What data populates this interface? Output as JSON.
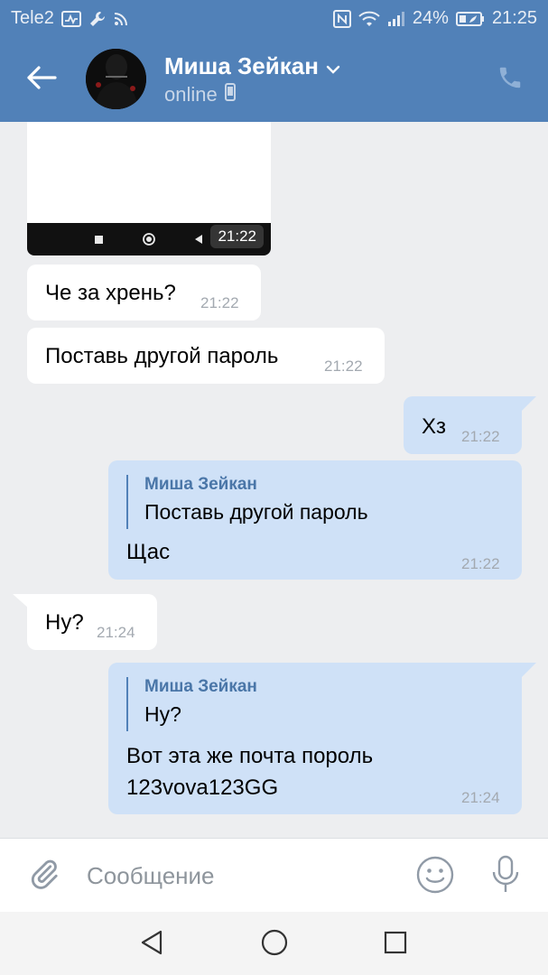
{
  "status_bar": {
    "carrier": "Tele2",
    "battery": "24%",
    "time": "21:25"
  },
  "header": {
    "name": "Миша Зейкан",
    "status": "online"
  },
  "messages": {
    "photo_time": "21:22",
    "m1": {
      "text": "Че за хрень?",
      "time": "21:22"
    },
    "m2": {
      "text": "Поставь другой пароль",
      "time": "21:22"
    },
    "m3": {
      "text": "Хз",
      "time": "21:22"
    },
    "m4": {
      "reply_author": "Миша Зейкан",
      "reply_text": "Поставь другой пароль",
      "text": "Щас",
      "time": "21:22"
    },
    "m5": {
      "text": "Ну?",
      "time": "21:24"
    },
    "m6": {
      "reply_author": "Миша Зейкан",
      "reply_text": "Ну?",
      "text_line1": "Вот эта же почта пороль",
      "text_line2": "123vova123GG",
      "time": "21:24"
    }
  },
  "composer": {
    "placeholder": "Сообщение",
    "value": ""
  },
  "icons": {
    "back": "arrow-left-icon",
    "call": "phone-icon",
    "attach": "paperclip-icon",
    "emoji": "smiley-icon",
    "mic": "microphone-icon"
  },
  "colors": {
    "header": "#5181b8",
    "incoming_bubble": "#ffffff",
    "outgoing_bubble": "#cfe1f7",
    "background": "#edeef0"
  }
}
